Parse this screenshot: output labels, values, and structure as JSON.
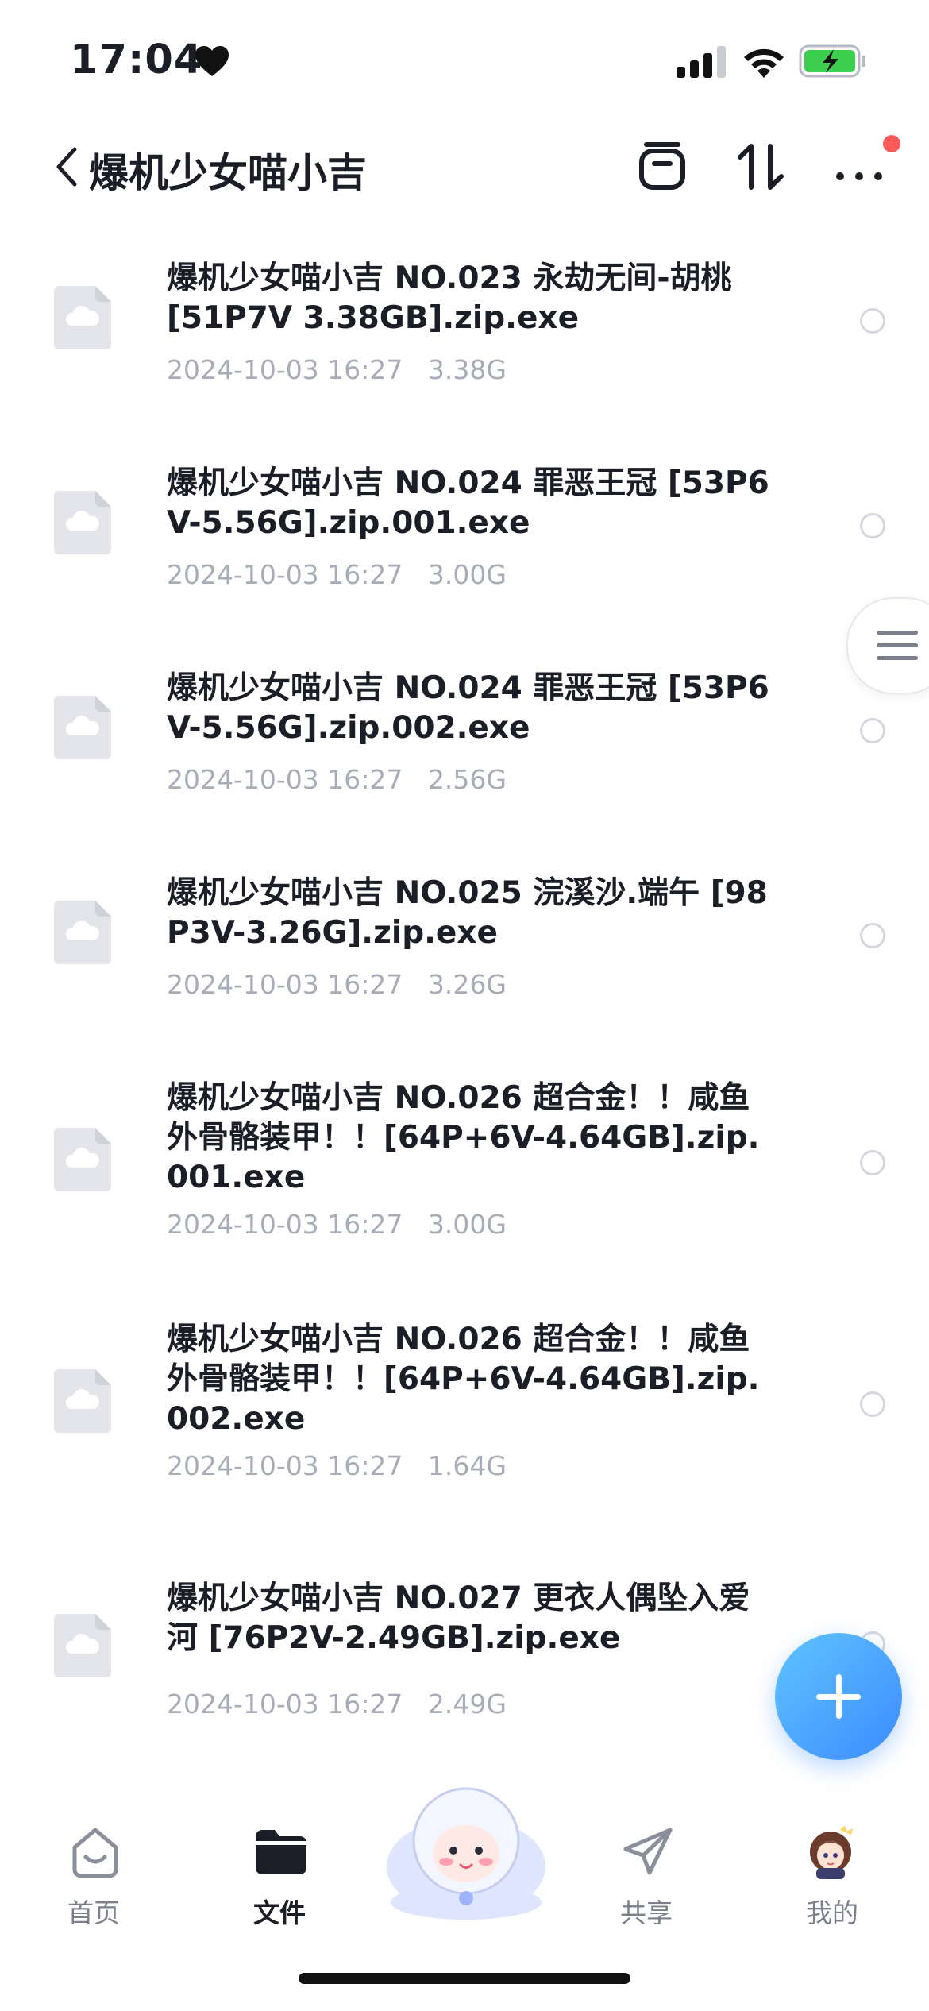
{
  "status_bar": {
    "time": "17:04"
  },
  "header": {
    "title": "爆机少女喵小吉"
  },
  "files": [
    {
      "name": "爆机少女喵小吉 NO.023 永劫无间-胡桃 [51P7V 3.38GB].zip.exe",
      "date": "2024-10-03 16:27",
      "size": "3.38G"
    },
    {
      "name": "爆机少女喵小吉 NO.024 罪恶王冠 [53P6V-5.56G].zip.001.exe",
      "date": "2024-10-03 16:27",
      "size": "3.00G"
    },
    {
      "name": "爆机少女喵小吉 NO.024 罪恶王冠 [53P6V-5.56G].zip.002.exe",
      "date": "2024-10-03 16:27",
      "size": "2.56G"
    },
    {
      "name": "爆机少女喵小吉 NO.025 浣溪沙.端午 [98P3V-3.26G].zip.exe",
      "date": "2024-10-03 16:27",
      "size": "3.26G"
    },
    {
      "name": "爆机少女喵小吉 NO.026 超合金！！咸鱼外骨骼装甲！！[64P+6V-4.64GB].zip.001.exe",
      "date": "2024-10-03 16:27",
      "size": "3.00G"
    },
    {
      "name": "爆机少女喵小吉 NO.026 超合金！！咸鱼外骨骼装甲！！[64P+6V-4.64GB].zip.002.exe",
      "date": "2024-10-03 16:27",
      "size": "1.64G"
    },
    {
      "name": "爆机少女喵小吉 NO.027 更衣人偶坠入爱河 [76P2V-2.49GB].zip.exe",
      "date": "2024-10-03 16:27",
      "size": "2.49G"
    }
  ],
  "nav": {
    "home": "首页",
    "files": "文件",
    "share": "共享",
    "mine": "我的"
  },
  "colors": {
    "accent": "#3d8bff",
    "badge": "#ff5a5a",
    "meta_text": "#a7acb8"
  }
}
